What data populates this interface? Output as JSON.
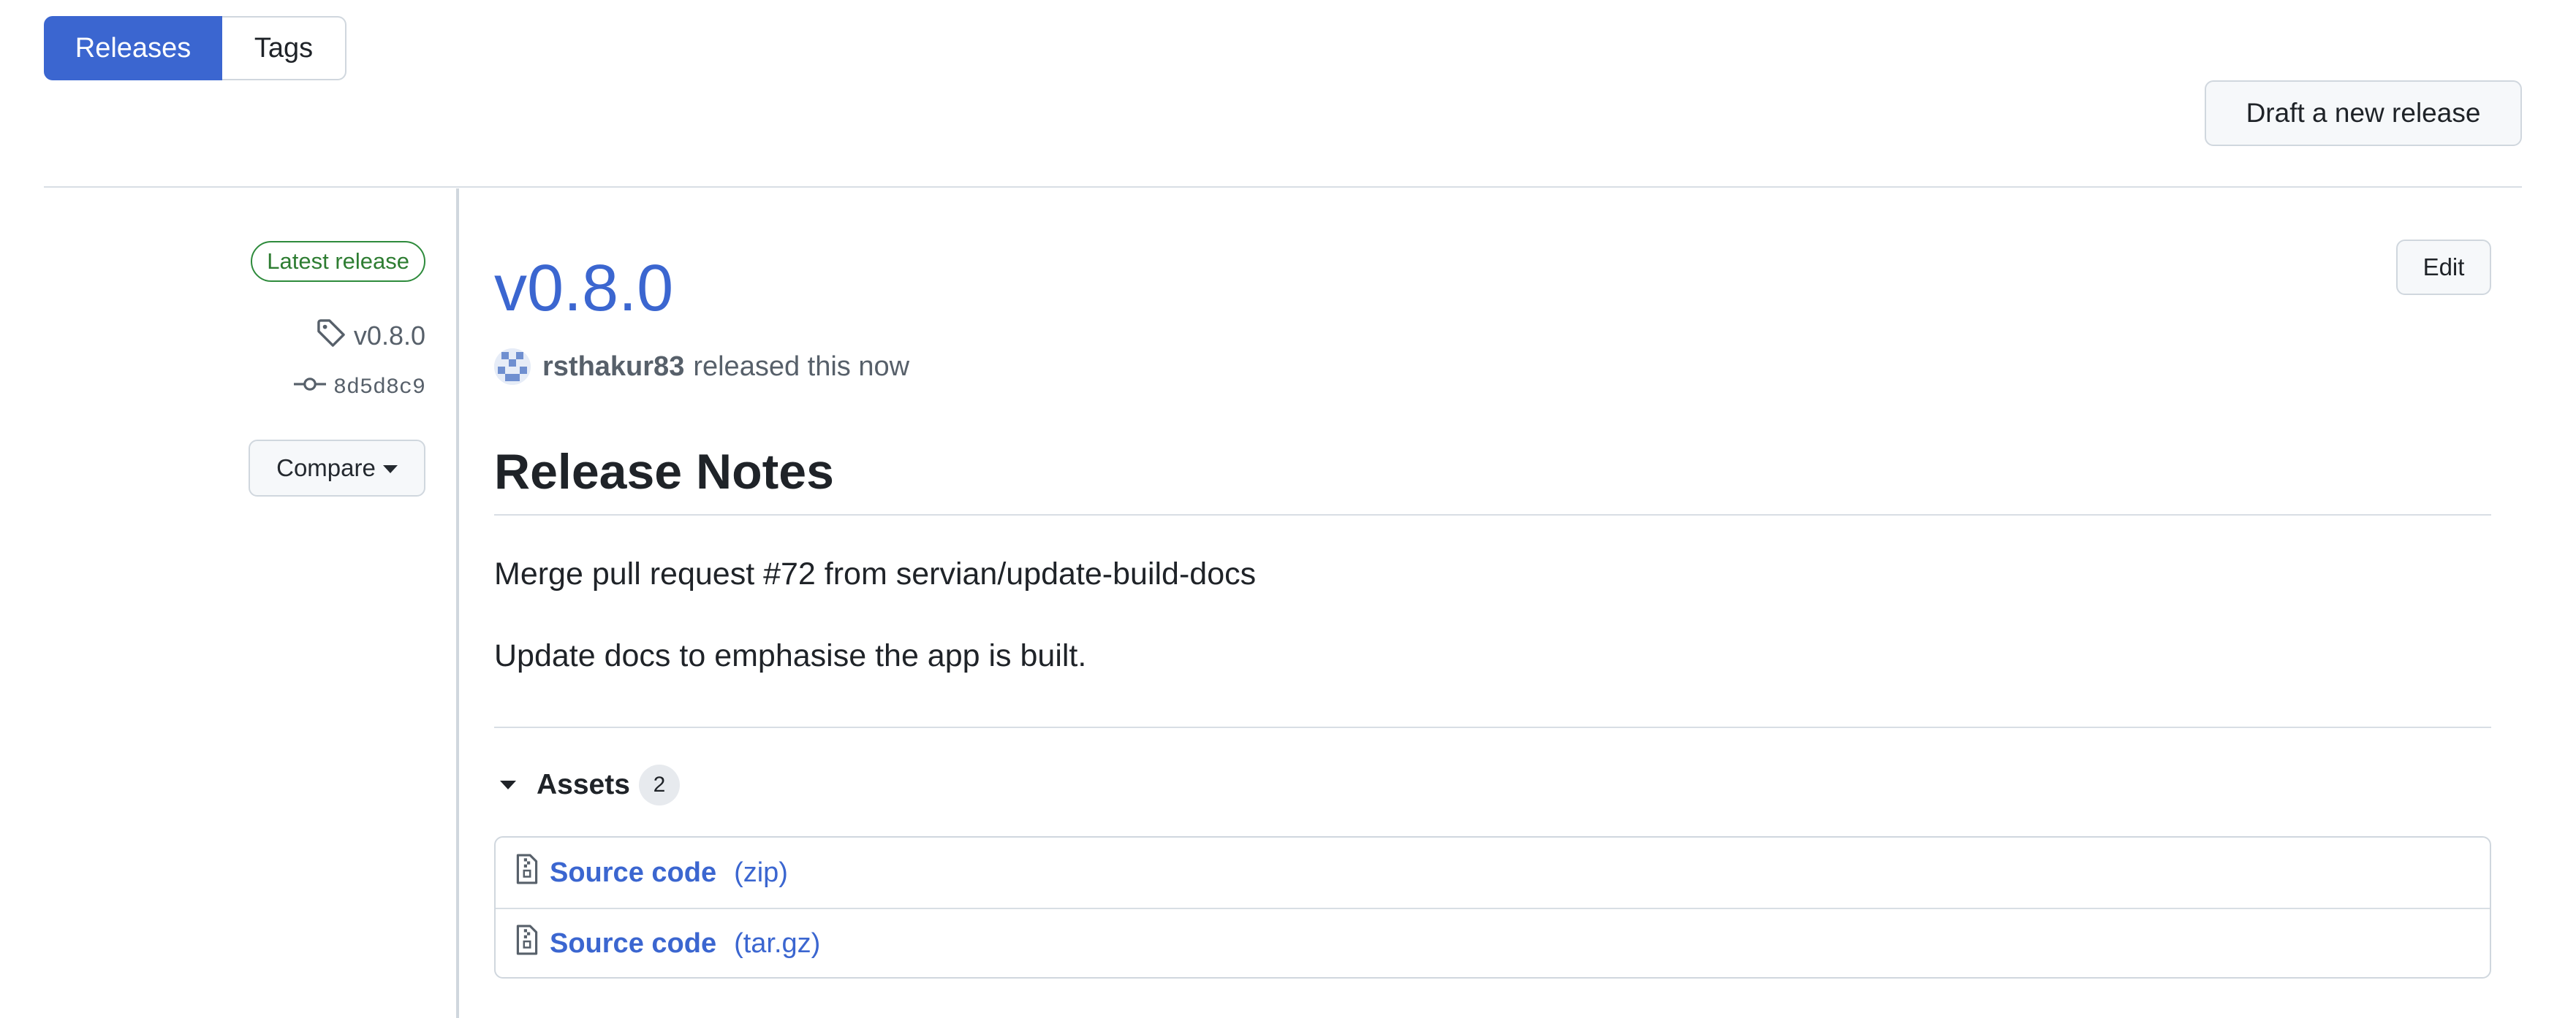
{
  "subnav": {
    "releases_label": "Releases",
    "tags_label": "Tags"
  },
  "header": {
    "draft_label": "Draft a new release"
  },
  "sidebar": {
    "latest_badge": "Latest release",
    "tag": "v0.8.0",
    "commit": "8d5d8c9",
    "compare_label": "Compare"
  },
  "release": {
    "title": "v0.8.0",
    "edit_label": "Edit",
    "author": "rsthakur83",
    "released_text": "released this now",
    "notes_heading": "Release Notes",
    "paragraphs": [
      "Merge pull request #72 from servian/update-build-docs",
      "Update docs to emphasise the app is built."
    ]
  },
  "assets": {
    "label": "Assets",
    "count": "2",
    "items": [
      {
        "name": "Source code",
        "ext": "(zip)"
      },
      {
        "name": "Source code",
        "ext": "(tar.gz)"
      }
    ]
  },
  "colors": {
    "accent": "#3b66d0",
    "latest_badge": "#2e8b3c"
  },
  "icons": [
    "tag-icon",
    "git-commit-icon",
    "caret-down-icon",
    "file-zip-icon",
    "triangle-down-icon"
  ]
}
